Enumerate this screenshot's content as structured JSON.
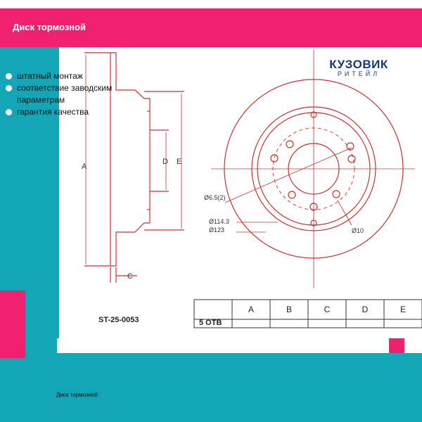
{
  "header": {
    "title": "Диск тормозной"
  },
  "features": [
    "штатный монтаж",
    "соответствие заводским параметрам",
    "гарантия качества"
  ],
  "logo": {
    "main": "КУЗОВИК",
    "sub": "РИТЕЙЛ"
  },
  "drawing": {
    "dim_A": "A",
    "dim_C": "C",
    "dim_D": "D",
    "dim_E": "E",
    "hole_dia": "Ø6.5(2)",
    "pcd": "Ø114.3",
    "center_bore": "Ø123",
    "bolt_dia": "Ø10",
    "part_number": "ST-25-0053",
    "table_row": "5 ОТВ",
    "table_headers": [
      "A",
      "B",
      "C",
      "D",
      "E"
    ]
  },
  "footer": {
    "caption": "Диск тормозной"
  },
  "colors": {
    "pink": "#f0206e",
    "teal": "#13a6b6",
    "drawing_red": "#c8322e",
    "logo_blue": "#1a3a74"
  }
}
